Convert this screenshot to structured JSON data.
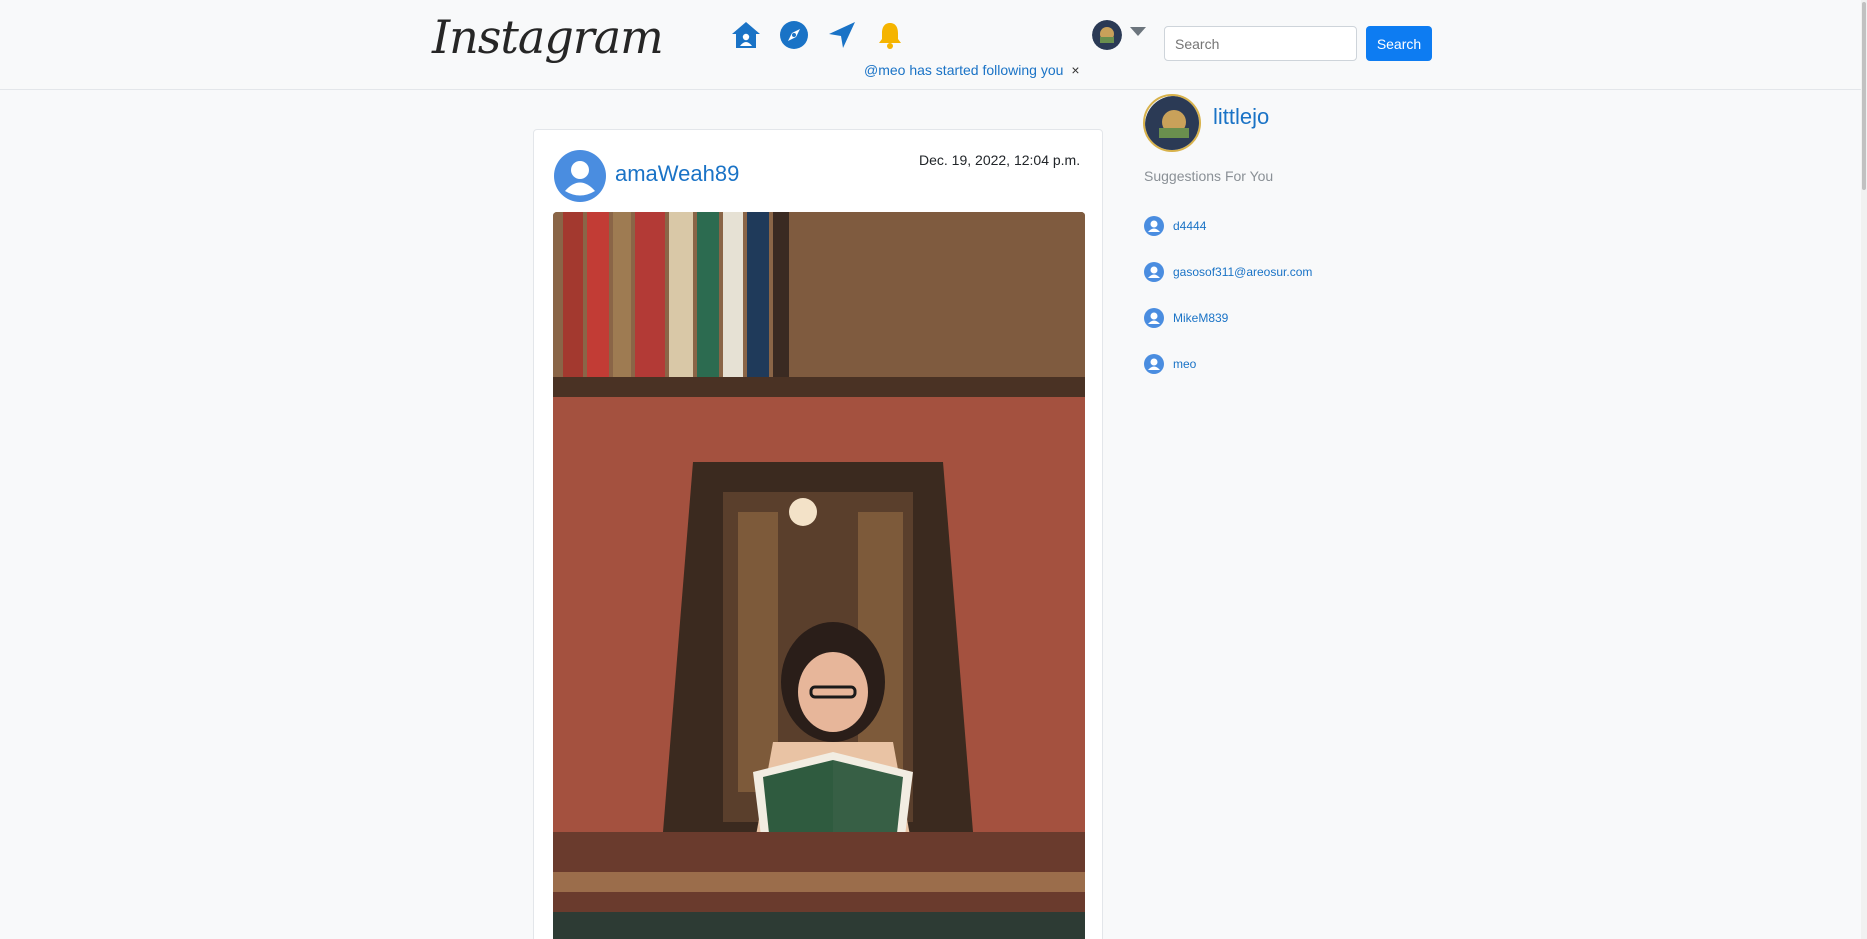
{
  "app": {
    "logo_text": "Instagram"
  },
  "nav": {
    "icons": [
      "home-icon",
      "explore-compass-icon",
      "direct-message-icon",
      "notification-bell-icon"
    ],
    "colors": {
      "primary": "#1a73c6",
      "bell": "#f5b400"
    }
  },
  "notification": {
    "text": "@meo has started following you",
    "close": "×"
  },
  "search": {
    "placeholder": "Search",
    "button_label": "Search"
  },
  "post": {
    "username": "amaWeah89",
    "date": "Dec. 19, 2022, 12:04 p.m.",
    "image_desc": "woman-reading-in-bookstore-photo"
  },
  "profile": {
    "username": "littlejo"
  },
  "suggestions": {
    "title": "Suggestions For You",
    "items": [
      {
        "name": "d4444"
      },
      {
        "name": "gasosof311@areosur.com"
      },
      {
        "name": "MikeM839"
      },
      {
        "name": "meo"
      }
    ]
  }
}
